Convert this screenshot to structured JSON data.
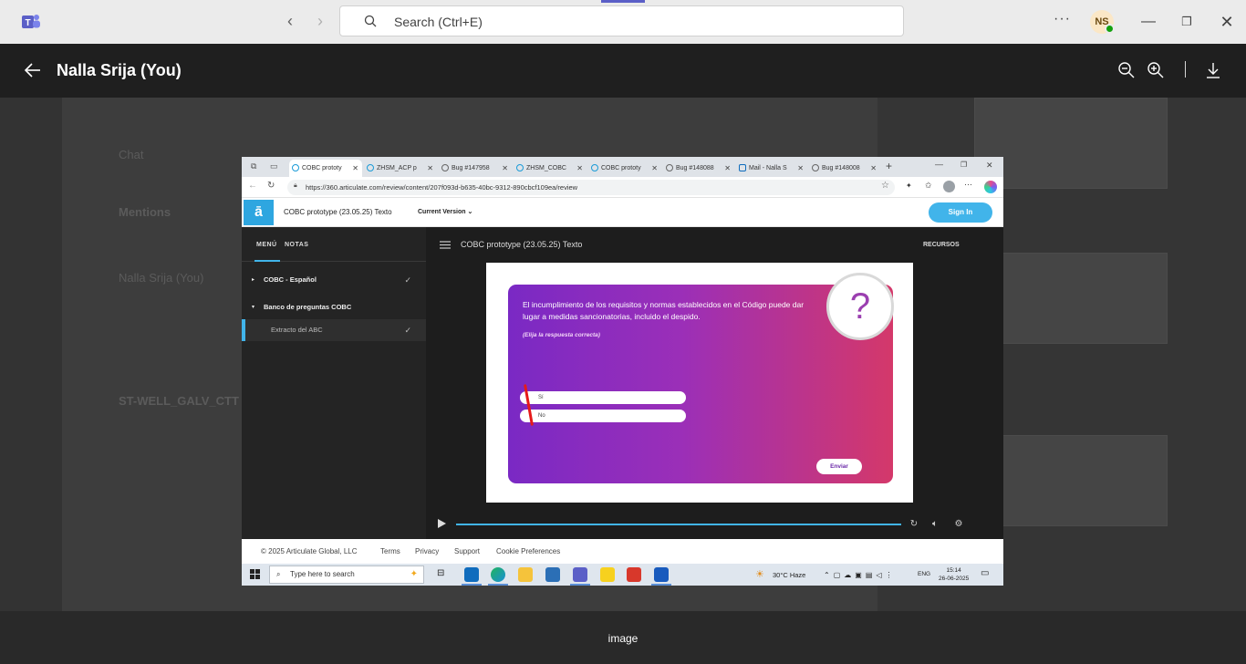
{
  "titlebar": {
    "search_placeholder": "Search (Ctrl+E)",
    "more": "···",
    "avatar_initials": "NS",
    "accent": "#5b5fc7"
  },
  "viewer": {
    "title": "Nalla Srija (You)",
    "caption": "image"
  },
  "background_list": [
    "Chat",
    "Mentions",
    "Nalla Srija (You)",
    "ST-WELL_GALV_CTT"
  ],
  "screenshot": {
    "browser_tabs": [
      {
        "label": "COBC prototy",
        "active": true
      },
      {
        "label": "ZHSM_ACP p",
        "active": false
      },
      {
        "label": "Bug #147958",
        "active": false
      },
      {
        "label": "ZHSM_COBC",
        "active": false
      },
      {
        "label": "COBC prototy",
        "active": false
      },
      {
        "label": "Bug #148088",
        "active": false
      },
      {
        "label": "Mail - Nalla S",
        "active": false
      },
      {
        "label": "Bug #148008",
        "active": false
      }
    ],
    "url": "https://360.articulate.com/review/content/207f093d-b635-40bc-9312-890cbcf109ea/review",
    "app": {
      "logo": "ā",
      "title": "COBC prototype (23.05.25) Texto",
      "version": "Current Version",
      "signin": "Sign In"
    },
    "player": {
      "tabs": [
        "MENÚ",
        "NOTAS"
      ],
      "menu": [
        {
          "label": "COBC - Español",
          "checked": true
        },
        {
          "label": "Banco de preguntas COBC",
          "checked": false
        },
        {
          "label": "Extracto del ABC",
          "checked": true
        }
      ],
      "title": "COBC prototype (23.05.25) Texto",
      "resources": "RECURSOS"
    },
    "quiz": {
      "question": "El incumplimiento de los requisitos y normas establecidos en el Código puede dar lugar a medidas sancionatorias, incluido el despido.",
      "hint": "(Elija la respuesta correcta)",
      "options": [
        "Sí",
        "No"
      ],
      "submit": "Enviar",
      "symbol": "?"
    },
    "footer": {
      "copyright": "© 2025 Articulate Global, LLC",
      "links": [
        "Terms",
        "Privacy",
        "Support",
        "Cookie Preferences"
      ]
    },
    "taskbar": {
      "search_placeholder": "Type here to search",
      "weather": "30°C  Haze",
      "lang": "ENG",
      "time": "15:14",
      "date": "26-06-2025"
    }
  }
}
